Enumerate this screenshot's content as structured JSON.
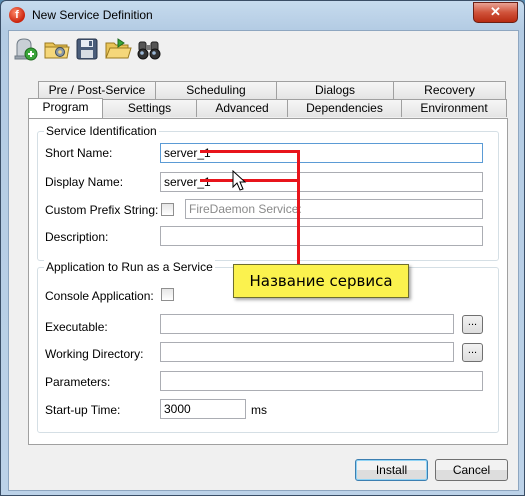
{
  "window": {
    "title": "New Service Definition",
    "app_icon_letter": "f",
    "close_glyph": "✕"
  },
  "toolbar": {
    "buttons": [
      {
        "name": "add-icon"
      },
      {
        "name": "settings-folder-icon"
      },
      {
        "name": "save-icon"
      },
      {
        "name": "open-folder-icon"
      },
      {
        "name": "binoculars-icon"
      }
    ]
  },
  "tabs": {
    "row_back": [
      "Pre / Post-Service",
      "Scheduling",
      "Dialogs",
      "Recovery"
    ],
    "row_front": [
      "Program",
      "Settings",
      "Advanced",
      "Dependencies",
      "Environment"
    ],
    "active": "Program"
  },
  "service_identification": {
    "title": "Service Identification",
    "short_name_label": "Short Name:",
    "short_name_value": "server_1",
    "display_name_label": "Display Name:",
    "display_name_value": "server_1",
    "custom_prefix_label": "Custom Prefix String:",
    "custom_prefix_checked": false,
    "custom_prefix_value": "FireDaemon Service:",
    "description_label": "Description:",
    "description_value": ""
  },
  "application": {
    "title": "Application to Run as a Service",
    "console_label": "Console Application:",
    "console_checked": false,
    "executable_label": "Executable:",
    "executable_value": "",
    "working_dir_label": "Working Directory:",
    "working_dir_value": "",
    "parameters_label": "Parameters:",
    "parameters_value": "",
    "startup_label": "Start-up Time:",
    "startup_value": "3000",
    "startup_unit": "ms",
    "browse_label": "..."
  },
  "buttons": {
    "install": "Install",
    "cancel": "Cancel"
  },
  "annotation": {
    "text": "Название сервиса",
    "line_color": "#e8141b",
    "box_color": "#fbf24e"
  }
}
